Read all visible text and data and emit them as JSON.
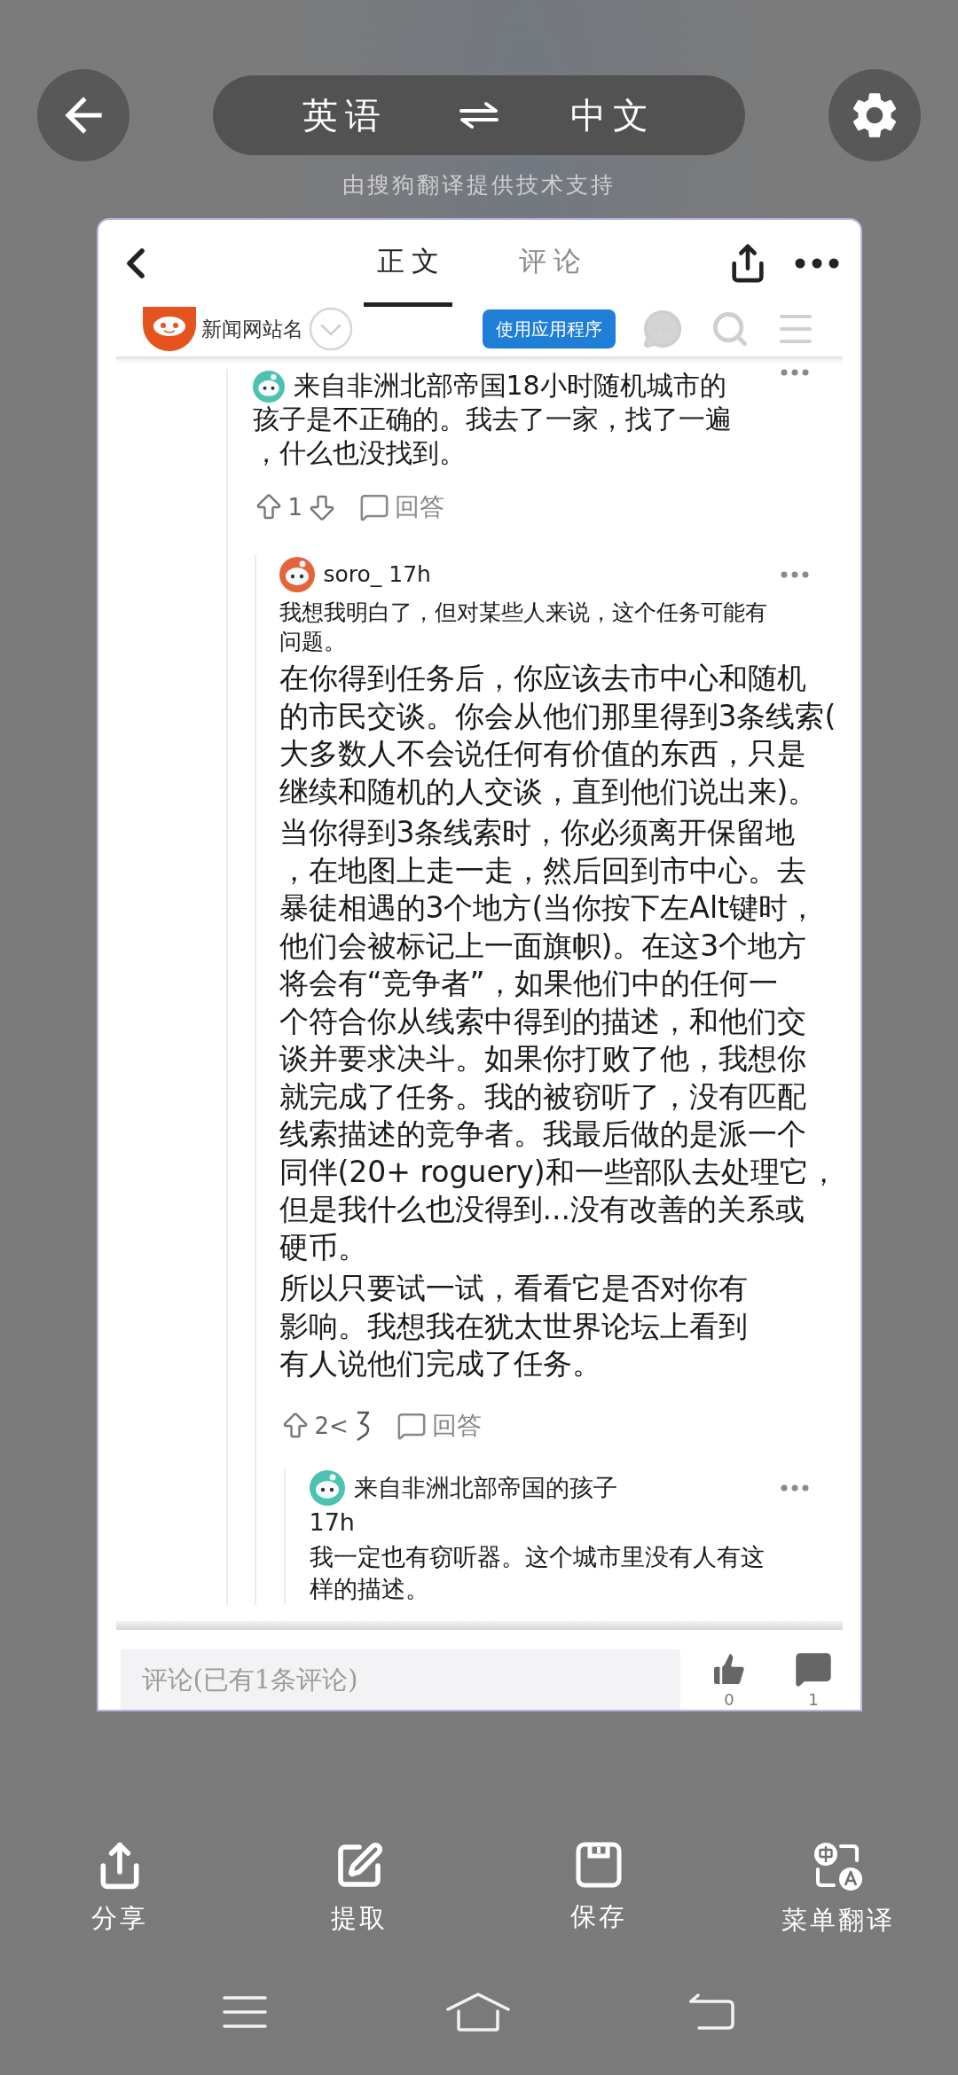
{
  "header": {
    "source_language": "英语",
    "target_language": "中文",
    "credit": "由搜狗翻译提供技术支持"
  },
  "article": {
    "tabs": [
      {
        "label": "正文",
        "selected": true
      },
      {
        "label": "评论",
        "selected": false
      }
    ],
    "site": {
      "name": "新闻网站名",
      "button": "使用应用程序"
    },
    "comments": [
      {
        "color": "#4cc3b2",
        "paragraphs": [
          {
            "kind": "body",
            "lines": [
              "来自非洲北部帝国18小时随机城市的",
              "孩子是不正确的。我去了一家，找了一遍",
              "，什么也没找到。"
            ]
          }
        ],
        "votes": {
          "kind": "arrows",
          "score": "1",
          "reply": "回答"
        },
        "children": [
          {
            "color": "#e4643c",
            "header": "soro_ 17h",
            "paragraphs": [
              {
                "kind": "note",
                "lines": [
                  "我想我明白了，但对某些人来说，这个任务可能有",
                  "问题。"
                ]
              },
              {
                "kind": "body",
                "lines": [
                  "在你得到任务后，你应该去市中心和随机",
                  "的市民交谈。你会从他们那里得到3条线索(",
                  "大多数人不会说任何有价值的东西，只是",
                  "继续和随机的人交谈，直到他们说出来)。"
                ]
              },
              {
                "kind": "body",
                "lines": [
                  "当你得到3条线索时，你必须离开保留地",
                  "，在地图上走一走，然后回到市中心。去",
                  "暴徒相遇的3个地方(当你按下左Alt键时，",
                  "他们会被标记上一面旗帜)。在这3个地方",
                  "将会有“竞争者”，如果他们中的任何一",
                  "个符合你从线索中得到的描述，和他们交",
                  "谈并要求决斗。如果你打败了他，我想你",
                  "就完成了任务。我的被窃听了，没有匹配",
                  "线索描述的竞争者。我最后做的是派一个",
                  "同伴(20+ roguery)和一些部队去处理它，",
                  "但是我什么也没得到...没有改善的关系或",
                  "硬币。"
                ]
              },
              {
                "kind": "body",
                "lines": [
                  "所以只要试一试，看看它是否对你有",
                  "影响。我想我在犹太世界论坛上看到",
                  "有人说他们完成了任务。"
                ]
              }
            ],
            "votes": {
              "kind": "garbled",
              "score": "2<",
              "reply": "回答"
            },
            "children": [
              {
                "color": "#4cc3b2",
                "header": "来自非洲北部帝国的孩子",
                "time": "17h",
                "paragraphs": [
                  {
                    "kind": "body",
                    "lines": [
                      "我一定也有窃听器。这个城市里没有人有这",
                      "样的描述。"
                    ]
                  }
                ]
              }
            ]
          }
        ]
      }
    ],
    "comment_bar": {
      "placeholder": "评论(已有1条评论)",
      "likes": "0",
      "comments": "1"
    }
  },
  "actions": [
    {
      "kind": "share",
      "label": "分享"
    },
    {
      "kind": "extract",
      "label": "提取"
    },
    {
      "kind": "save",
      "label": "保存"
    },
    {
      "kind": "translate",
      "label": "菜单翻译"
    }
  ]
}
